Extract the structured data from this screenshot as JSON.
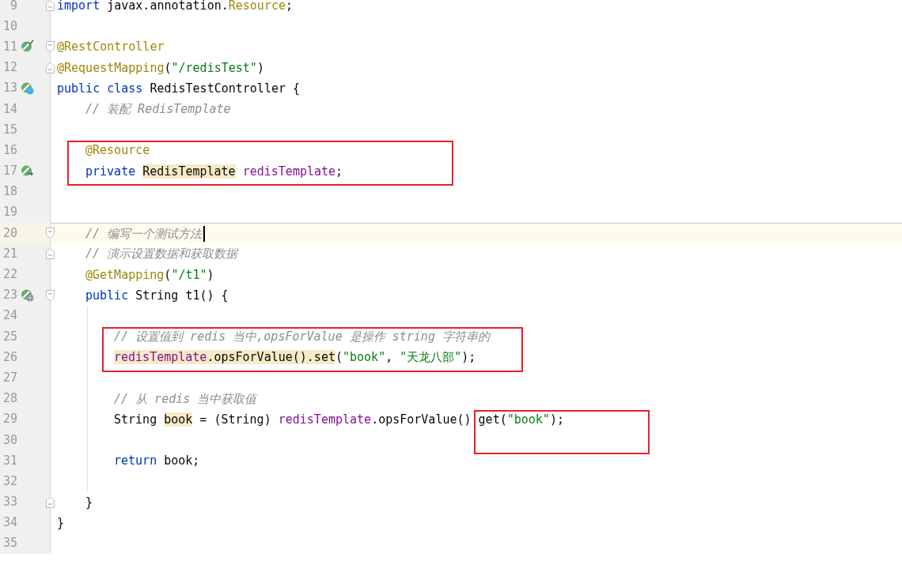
{
  "editor": {
    "lines": [
      {
        "number": "9",
        "fold_marker": {
          "kind": "close"
        },
        "tokens": [
          {
            "text": "import",
            "kind": "keyword"
          },
          {
            "text": " javax.annotation.",
            "kind": "plain"
          },
          {
            "text": "Resource",
            "kind": "annotation"
          },
          {
            "text": ";",
            "kind": "plain"
          }
        ]
      },
      {
        "number": "10"
      },
      {
        "number": "11",
        "gutter_icon": {
          "kind": "check"
        },
        "fold_marker": {
          "kind": "open"
        },
        "tokens": [
          {
            "text": "@RestController",
            "kind": "annotation"
          }
        ]
      },
      {
        "number": "12",
        "fold_marker": {
          "kind": "close"
        },
        "tokens": [
          {
            "text": "@RequestMapping",
            "kind": "annotation"
          },
          {
            "text": "(",
            "kind": "plain"
          },
          {
            "text": "\"/redisTest\"",
            "kind": "string"
          },
          {
            "text": ")",
            "kind": "plain"
          }
        ]
      },
      {
        "number": "13",
        "gutter_icon": {
          "kind": "class"
        },
        "tokens": [
          {
            "text": "public class",
            "kind": "keyword"
          },
          {
            "text": " RedisTestController {",
            "kind": "plain"
          }
        ]
      },
      {
        "number": "14",
        "indent": {
          "kind": "member"
        },
        "tokens": [
          {
            "text": "// 装配 RedisTemplate",
            "kind": "comment"
          }
        ]
      },
      {
        "number": "15"
      },
      {
        "number": "16",
        "indent": {
          "kind": "member"
        },
        "marked": true,
        "tokens": [
          {
            "text": "@Resource",
            "kind": "annotation"
          }
        ]
      },
      {
        "number": "17",
        "indent": {
          "kind": "member"
        },
        "gutter_icon": {
          "kind": "link"
        },
        "marked": true,
        "tokens": [
          {
            "text": "private ",
            "kind": "keyword"
          },
          {
            "text": "RedisTemplate",
            "kind": "plain",
            "highlighted": true
          },
          {
            "text": " redisTemplate",
            "kind": "field"
          },
          {
            "text": ";",
            "kind": "plain"
          }
        ]
      },
      {
        "number": "18"
      },
      {
        "number": "19"
      },
      {
        "number": "20",
        "indent": {
          "kind": "member"
        },
        "fold_marker": {
          "kind": "open"
        },
        "current": true,
        "method_separator": true,
        "tokens": [
          {
            "text": "// 编写一个测试方法",
            "kind": "comment"
          }
        ]
      },
      {
        "number": "21",
        "indent": {
          "kind": "member"
        },
        "fold_marker": {
          "kind": "close"
        },
        "tokens": [
          {
            "text": "// 演示设置数据和获取数据",
            "kind": "comment"
          }
        ]
      },
      {
        "number": "22",
        "indent": {
          "kind": "member"
        },
        "tokens": [
          {
            "text": "@GetMapping",
            "kind": "annotation"
          },
          {
            "text": "(",
            "kind": "plain"
          },
          {
            "text": "\"/t1\"",
            "kind": "string"
          },
          {
            "text": ")",
            "kind": "plain"
          }
        ]
      },
      {
        "number": "23",
        "indent": {
          "kind": "member"
        },
        "gutter_icon": {
          "kind": "web"
        },
        "fold_marker": {
          "kind": "open"
        },
        "tokens": [
          {
            "text": "public",
            "kind": "keyword"
          },
          {
            "text": " String t1() {",
            "kind": "plain"
          }
        ]
      },
      {
        "number": "24",
        "indent_guide": true
      },
      {
        "number": "25",
        "indent": {
          "kind": "statement"
        },
        "indent_guide": true,
        "marked": true,
        "tokens": [
          {
            "text": "// 设置值到 redis 当中,opsForValue 是操作 string 字符串的",
            "kind": "comment"
          }
        ]
      },
      {
        "number": "26",
        "indent": {
          "kind": "statement"
        },
        "indent_guide": true,
        "marked": true,
        "tokens": [
          {
            "text": "redisTemplate",
            "kind": "field",
            "highlighted": true
          },
          {
            "text": ".opsForValue().set",
            "kind": "plain",
            "highlighted": true
          },
          {
            "text": "(",
            "kind": "plain"
          },
          {
            "text": "\"book\"",
            "kind": "string"
          },
          {
            "text": ", ",
            "kind": "plain"
          },
          {
            "text": "\"天龙八部\"",
            "kind": "string"
          },
          {
            "text": ");",
            "kind": "plain"
          }
        ]
      },
      {
        "number": "27",
        "indent_guide": true
      },
      {
        "number": "28",
        "indent": {
          "kind": "statement"
        },
        "indent_guide": true,
        "tokens": [
          {
            "text": "// 从 redis 当中获取值",
            "kind": "comment"
          }
        ]
      },
      {
        "number": "29",
        "indent": {
          "kind": "statement"
        },
        "indent_guide": true,
        "marked": true,
        "tokens": [
          {
            "text": "String ",
            "kind": "plain"
          },
          {
            "text": "book",
            "kind": "plain",
            "highlighted": true
          },
          {
            "text": " = (String) ",
            "kind": "plain"
          },
          {
            "text": "redisTemplate",
            "kind": "field"
          },
          {
            "text": ".opsForValue().get(",
            "kind": "plain"
          },
          {
            "text": "\"book\"",
            "kind": "string"
          },
          {
            "text": ");",
            "kind": "plain"
          }
        ]
      },
      {
        "number": "30",
        "indent_guide": true,
        "marked": true
      },
      {
        "number": "31",
        "indent": {
          "kind": "statement"
        },
        "indent_guide": true,
        "tokens": [
          {
            "text": "return",
            "kind": "keyword"
          },
          {
            "text": " book;",
            "kind": "plain"
          }
        ]
      },
      {
        "number": "32",
        "indent_guide": true
      },
      {
        "number": "33",
        "indent": {
          "kind": "member"
        },
        "fold_marker": {
          "kind": "close"
        },
        "tokens": [
          {
            "text": "}",
            "kind": "plain"
          }
        ]
      },
      {
        "number": "34",
        "tokens": [
          {
            "text": "}",
            "kind": "plain"
          }
        ]
      },
      {
        "number": "35"
      }
    ]
  }
}
